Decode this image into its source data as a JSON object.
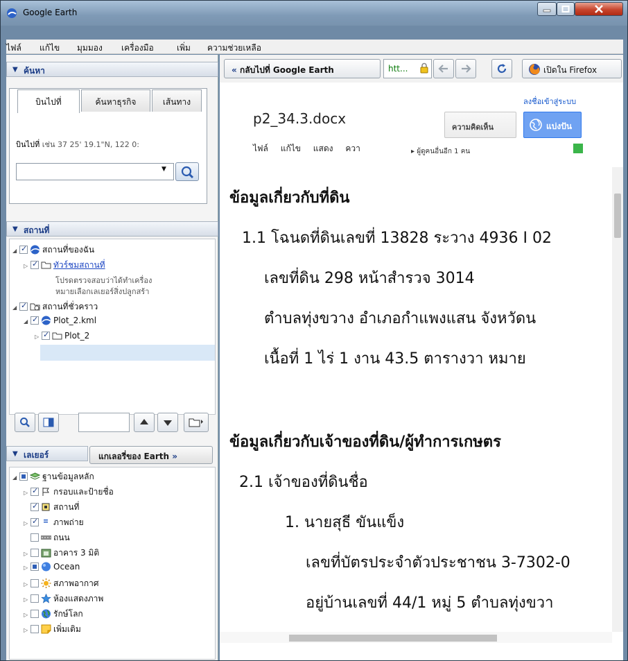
{
  "window": {
    "title": "Google Earth"
  },
  "menu": [
    "ไฟล์",
    "แก้ไข",
    "มุมมอง",
    "เครื่องมือ",
    "เพิ่ม",
    "ความช่วยเหลือ"
  ],
  "search": {
    "header": "ค้นหา",
    "tabs": [
      "บินไปที่",
      "ค้นหาธุรกิจ",
      "เส้นทาง"
    ],
    "hint_label": "บินไปที่",
    "hint_example": "เช่น 37 25' 19.1\"N, 122 0:",
    "input_value": ""
  },
  "places": {
    "header": "สถานที่",
    "my_places": "สถานที่ของฉัน",
    "tour": "ทัวร์ชมสถานที่",
    "tour_note_1": "โปรดตรวจสอบว่าได้ทำเครื่อง",
    "tour_note_2": "หมายเลือกเลเยอร์สิ่งปลูกสร้า",
    "temp_places": "สถานที่ชั่วคราว",
    "kml_file": "Plot_2.kml",
    "folder": "Plot_2"
  },
  "layers": {
    "header": "เลเยอร์",
    "gallery_button": "แกเลอรี่ของ Earth",
    "gallery_arrow": "»",
    "items": [
      {
        "label": "ฐานข้อมูลหลัก",
        "checked": "partial"
      },
      {
        "label": "กรอบและป้ายชื่อ",
        "checked": true
      },
      {
        "label": "สถานที่",
        "checked": true
      },
      {
        "label": "ภาพถ่าย",
        "checked": true
      },
      {
        "label": "ถนน",
        "checked": false
      },
      {
        "label": "อาคาร 3 มิติ",
        "checked": false
      },
      {
        "label": "Ocean",
        "checked": "partial"
      },
      {
        "label": "สภาพอากาศ",
        "checked": false
      },
      {
        "label": "ห้องแสดงภาพ",
        "checked": false
      },
      {
        "label": "รักษ์โลก",
        "checked": false
      },
      {
        "label": "เพิ่มเติม",
        "checked": false
      }
    ]
  },
  "browser": {
    "back_label": "กลับไปที่ Google Earth",
    "back_chevron": "«",
    "url": "htt...",
    "open_firefox": "เปิดใน Firefox"
  },
  "doc": {
    "signin": "ลงชื่อเข้าสู่ระบบ",
    "title": "p2_34.3.docx",
    "menu": [
      "ไฟล์",
      "แก้ไข",
      "แสดง",
      "ควา"
    ],
    "comment_btn": "ความคิดเห็น",
    "share_btn": "แบ่งปัน",
    "viewers": "ผู้ดูคนอื่นอีก 1 คน",
    "lines": [
      "ข้อมูลเกี่ยวกับที่ดิน",
      "1.1  โฉนดที่ดินเลขที่  13828  ระวาง  4936 I 02",
      "เลขที่ดิน  298  หน้าสำรวจ  3014",
      "ตำบลทุ่งขวาง  อำเภอกำแพงแสน  จังหวัดน",
      "เนื้อที่  1 ไร่  1  งาน  43.5  ตารางวา  หมาย",
      "ข้อมูลเกี่ยวกับเจ้าของที่ดิน/ผู้ทำการเกษตร",
      "2.1  เจ้าของที่ดินชื่อ",
      "1.  นายสุธี  ขันแข็ง",
      "เลขที่บัตรประจำตัวประชาชน  3-7302-0",
      "อยู่บ้านเลขที่  44/1 หมู่  5  ตำบลทุ่งขวา"
    ]
  }
}
